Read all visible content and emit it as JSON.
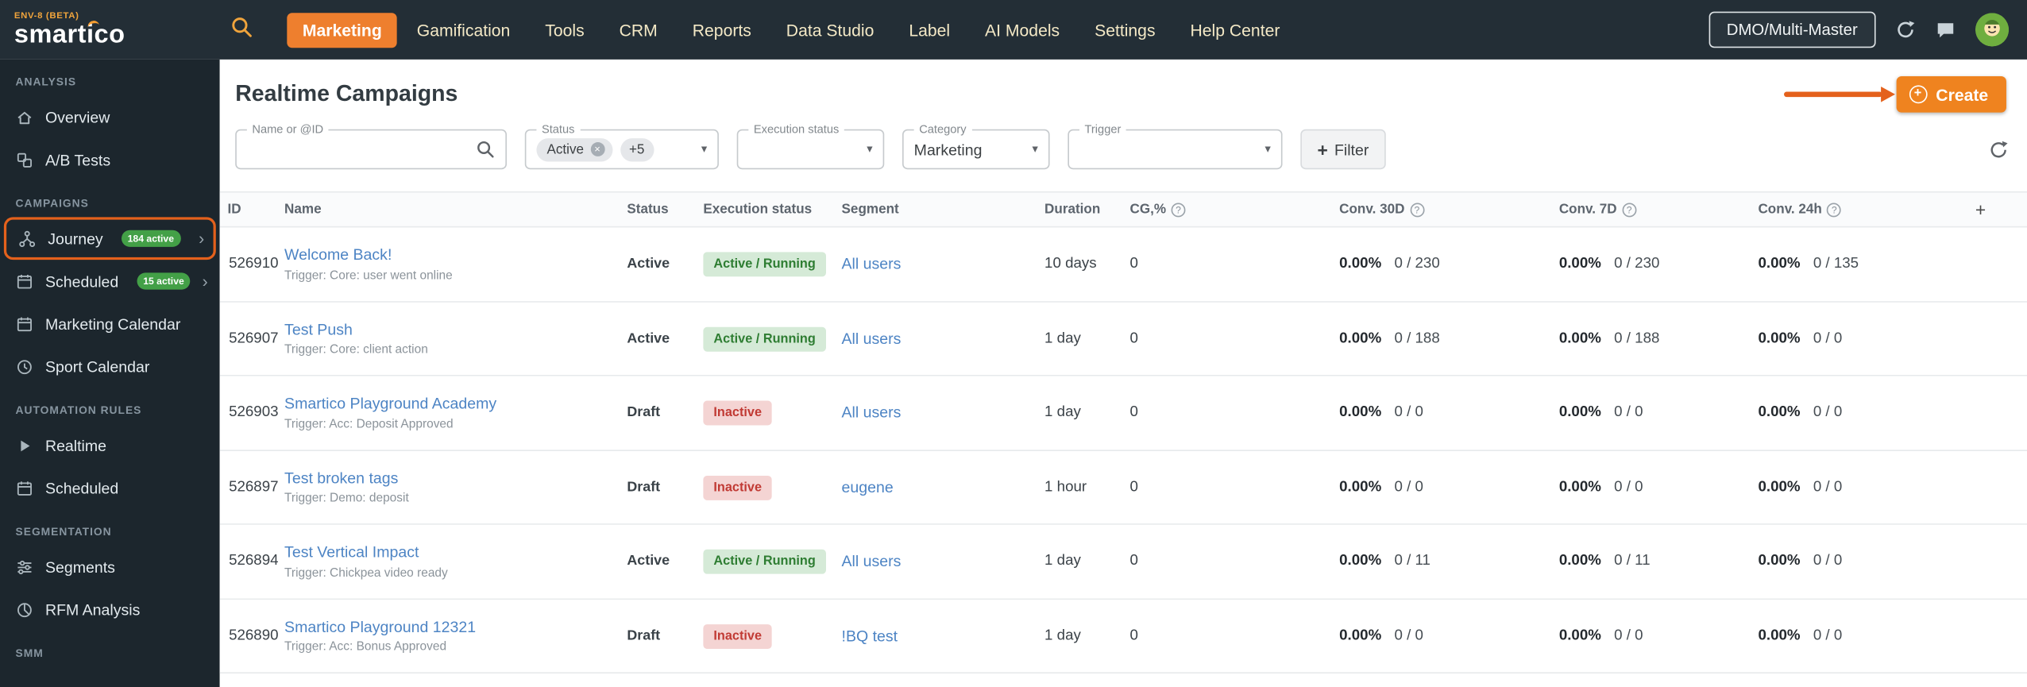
{
  "brand": {
    "env_label": "ENV-8 (BETA)",
    "logo_text": "smartico"
  },
  "topnav": {
    "items": [
      {
        "label": "Marketing",
        "active": true
      },
      {
        "label": "Gamification"
      },
      {
        "label": "Tools"
      },
      {
        "label": "CRM"
      },
      {
        "label": "Reports"
      },
      {
        "label": "Data Studio"
      },
      {
        "label": "Label"
      },
      {
        "label": "AI Models"
      },
      {
        "label": "Settings"
      },
      {
        "label": "Help Center"
      }
    ],
    "account_selector": "DMO/Multi-Master"
  },
  "sidebar": {
    "sections": [
      {
        "title": "ANALYSIS",
        "items": [
          {
            "label": "Overview"
          },
          {
            "label": "A/B Tests"
          }
        ]
      },
      {
        "title": "CAMPAIGNS",
        "items": [
          {
            "label": "Journey",
            "badge": "184 active"
          },
          {
            "label": "Scheduled",
            "badge": "15 active"
          },
          {
            "label": "Marketing Calendar"
          },
          {
            "label": "Sport Calendar"
          }
        ]
      },
      {
        "title": "AUTOMATION RULES",
        "items": [
          {
            "label": "Realtime"
          },
          {
            "label": "Scheduled"
          }
        ]
      },
      {
        "title": "SEGMENTATION",
        "items": [
          {
            "label": "Segments"
          },
          {
            "label": "RFM Analysis"
          }
        ]
      },
      {
        "title": "SMM",
        "items": []
      }
    ]
  },
  "page": {
    "title": "Realtime Campaigns",
    "create_label": "Create"
  },
  "filters": {
    "name_label": "Name or @ID",
    "status_label": "Status",
    "status_chip": "Active",
    "status_more": "+5",
    "execution_label": "Execution status",
    "category_label": "Category",
    "category_value": "Marketing",
    "trigger_label": "Trigger",
    "filter_button": "Filter"
  },
  "table": {
    "columns": [
      {
        "label": "ID"
      },
      {
        "label": "Name"
      },
      {
        "label": "Status"
      },
      {
        "label": "Execution status"
      },
      {
        "label": "Segment"
      },
      {
        "label": "Duration"
      },
      {
        "label": "CG,%",
        "help": true
      },
      {
        "label": "Conv. 30D",
        "help": true
      },
      {
        "label": "Conv. 7D",
        "help": true
      },
      {
        "label": "Conv. 24h",
        "help": true
      }
    ],
    "rows": [
      {
        "id": "526910",
        "name": "Welcome Back!",
        "trigger": "Trigger: Core: user went online",
        "status": "Active",
        "execution": "Active / Running",
        "execution_state": "active",
        "segment": "All users",
        "duration": "10 days",
        "cg": "0",
        "conv_30d_pct": "0.00%",
        "conv_30d_count": "0 / 230",
        "conv_7d_pct": "0.00%",
        "conv_7d_count": "0 / 230",
        "conv_24h_pct": "0.00%",
        "conv_24h_count": "0 / 135"
      },
      {
        "id": "526907",
        "name": "Test Push",
        "trigger": "Trigger: Core: client action",
        "status": "Active",
        "execution": "Active / Running",
        "execution_state": "active",
        "segment": "All users",
        "duration": "1 day",
        "cg": "0",
        "conv_30d_pct": "0.00%",
        "conv_30d_count": "0 / 188",
        "conv_7d_pct": "0.00%",
        "conv_7d_count": "0 / 188",
        "conv_24h_pct": "0.00%",
        "conv_24h_count": "0 / 0"
      },
      {
        "id": "526903",
        "name": "Smartico Playground Academy",
        "trigger": "Trigger: Acc: Deposit Approved",
        "status": "Draft",
        "execution": "Inactive",
        "execution_state": "inactive",
        "segment": "All users",
        "duration": "1 day",
        "cg": "0",
        "conv_30d_pct": "0.00%",
        "conv_30d_count": "0 / 0",
        "conv_7d_pct": "0.00%",
        "conv_7d_count": "0 / 0",
        "conv_24h_pct": "0.00%",
        "conv_24h_count": "0 / 0"
      },
      {
        "id": "526897",
        "name": "Test broken tags",
        "trigger": "Trigger: Demo: deposit",
        "status": "Draft",
        "execution": "Inactive",
        "execution_state": "inactive",
        "segment": "eugene",
        "duration": "1 hour",
        "cg": "0",
        "conv_30d_pct": "0.00%",
        "conv_30d_count": "0 / 0",
        "conv_7d_pct": "0.00%",
        "conv_7d_count": "0 / 0",
        "conv_24h_pct": "0.00%",
        "conv_24h_count": "0 / 0"
      },
      {
        "id": "526894",
        "name": "Test Vertical Impact",
        "trigger": "Trigger: Chickpea video ready",
        "status": "Active",
        "execution": "Active / Running",
        "execution_state": "active",
        "segment": "All users",
        "duration": "1 day",
        "cg": "0",
        "conv_30d_pct": "0.00%",
        "conv_30d_count": "0 / 11",
        "conv_7d_pct": "0.00%",
        "conv_7d_count": "0 / 11",
        "conv_24h_pct": "0.00%",
        "conv_24h_count": "0 / 0"
      },
      {
        "id": "526890",
        "name": "Smartico Playground 12321",
        "trigger": "Trigger: Acc: Bonus Approved",
        "status": "Draft",
        "execution": "Inactive",
        "execution_state": "inactive",
        "segment": "!BQ test",
        "duration": "1 day",
        "cg": "0",
        "conv_30d_pct": "0.00%",
        "conv_30d_count": "0 / 0",
        "conv_7d_pct": "0.00%",
        "conv_7d_count": "0 / 0",
        "conv_24h_pct": "0.00%",
        "conv_24h_count": "0 / 0"
      }
    ]
  },
  "icons": {
    "help": "?",
    "caret": "▾",
    "chevron": "›",
    "close": "×",
    "plus": "+"
  },
  "colors": {
    "topbar_bg": "#232e36",
    "sidebar_bg": "#1c262d",
    "accent_orange": "#ef831f",
    "annotation_orange": "#e4611c",
    "badge_green": "#43a047",
    "link_blue": "#4d84c4",
    "exec_active_bg": "#d5ead7",
    "exec_active_text": "#2e7d32",
    "exec_inactive_bg": "#f4d4d3",
    "exec_inactive_text": "#c13a34"
  }
}
